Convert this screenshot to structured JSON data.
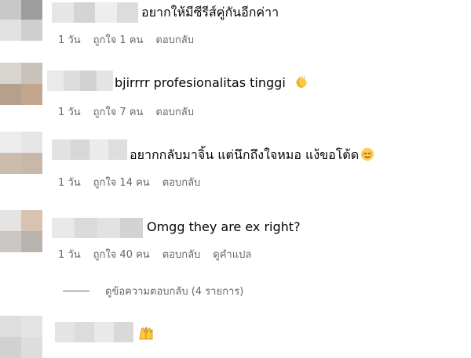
{
  "comments": [
    {
      "text": "อยากให้มีซีรีส์คู่กันอีกค่าา",
      "time": "1 วัน",
      "like": "ถูกใจ 1 คน",
      "reply": "ตอบกลับ",
      "emoji": ""
    },
    {
      "text": "bjirrrr profesionalitas tinggi",
      "time": "1 วัน",
      "like": "ถูกใจ 7 คน",
      "reply": "ตอบกลับ",
      "emoji": "clapping-hands"
    },
    {
      "text": "อยากกลับมาจิ้น แต่นึกถึงใจหมอ แง้ขอโต้ด",
      "time": "1 วัน",
      "like": "ถูกใจ 14 คน",
      "reply": "ตอบกลับ",
      "emoji": "relieved-face"
    },
    {
      "text": "Omgg they are ex right?",
      "time": "1 วัน",
      "like": "ถูกใจ 40 คน",
      "reply": "ตอบกลับ",
      "translate": "ดูคำแปล"
    }
  ],
  "view_replies": "ดูข้อความตอบกลับ (4 รายการ)",
  "last_comment_emoji": "raising-hands"
}
